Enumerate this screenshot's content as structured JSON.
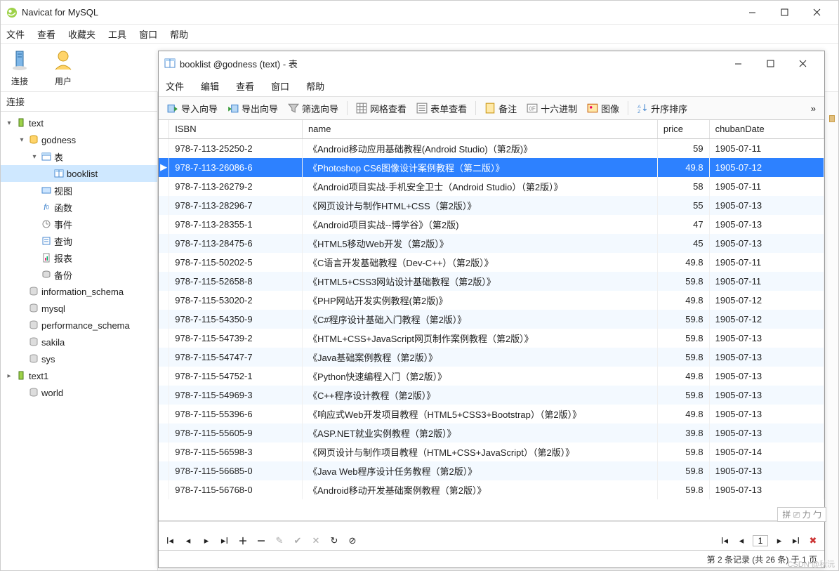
{
  "app": {
    "title": "Navicat for MySQL",
    "menubar": [
      "文件",
      "查看",
      "收藏夹",
      "工具",
      "窗口",
      "帮助"
    ],
    "toolbar": [
      {
        "label": "连接",
        "icon": "server"
      },
      {
        "label": "用户",
        "icon": "user"
      }
    ],
    "sidebar_title": "连接"
  },
  "tree": {
    "root": {
      "label": "text",
      "expanded": true
    },
    "db": {
      "label": "godness",
      "expanded": true
    },
    "tables_group": {
      "label": "表",
      "expanded": true
    },
    "table_item": {
      "label": "booklist"
    },
    "others": [
      "视图",
      "函数",
      "事件",
      "查询",
      "报表",
      "备份"
    ],
    "rest": [
      "information_schema",
      "mysql",
      "performance_schema",
      "sakila",
      "sys",
      "text1",
      "world"
    ]
  },
  "sub": {
    "title": "booklist @godness (text) - 表",
    "menubar": [
      "文件",
      "编辑",
      "查看",
      "窗口",
      "帮助"
    ],
    "toolbar": {
      "import": "导入向导",
      "export": "导出向导",
      "filter": "筛选向导",
      "gridview": "网格查看",
      "formview": "表单查看",
      "memo": "备注",
      "hex": "十六进制",
      "image": "图像",
      "sort": "升序排序"
    },
    "columns": [
      "ISBN",
      "name",
      "price",
      "chubanDate"
    ],
    "rows": [
      [
        "978-7-113-25250-2",
        "《Android移动应用基础教程(Android Studio)（第2版)》",
        "59",
        "1905-07-11"
      ],
      [
        "978-7-113-26086-6",
        "《Photoshop CS6图像设计案例教程（第二版）》",
        "49.8",
        "1905-07-12"
      ],
      [
        "978-7-113-26279-2",
        "《Android项目实战-手机安全卫士（Android Studio）（第2版）》",
        "58",
        "1905-07-11"
      ],
      [
        "978-7-113-28296-7",
        "《网页设计与制作HTML+CSS（第2版）》",
        "55",
        "1905-07-13"
      ],
      [
        "978-7-113-28355-1",
        "《Android项目实战--博学谷》（第2版)",
        "47",
        "1905-07-13"
      ],
      [
        "978-7-113-28475-6",
        "《HTML5移动Web开发（第2版）》",
        "45",
        "1905-07-13"
      ],
      [
        "978-7-115-50202-5",
        "《C语言开发基础教程（Dev-C++）（第2版）》",
        "49.8",
        "1905-07-11"
      ],
      [
        "978-7-115-52658-8",
        "《HTML5+CSS3网站设计基础教程（第2版）》",
        "59.8",
        "1905-07-11"
      ],
      [
        "978-7-115-53020-2",
        "《PHP网站开发实例教程(第2版)》",
        "49.8",
        "1905-07-12"
      ],
      [
        "978-7-115-54350-9",
        "《C#程序设计基础入门教程（第2版）》",
        "59.8",
        "1905-07-12"
      ],
      [
        "978-7-115-54739-2",
        "《HTML+CSS+JavaScript网页制作案例教程（第2版）》",
        "59.8",
        "1905-07-13"
      ],
      [
        "978-7-115-54747-7",
        "《Java基础案例教程（第2版）》",
        "59.8",
        "1905-07-13"
      ],
      [
        "978-7-115-54752-1",
        "《Python快速编程入门（第2版）》",
        "49.8",
        "1905-07-13"
      ],
      [
        "978-7-115-54969-3",
        "《C++程序设计教程（第2版）》",
        "59.8",
        "1905-07-13"
      ],
      [
        "978-7-115-55396-6",
        "《响应式Web开发项目教程（HTML5+CSS3+Bootstrap）（第2版）》",
        "49.8",
        "1905-07-13"
      ],
      [
        "978-7-115-55605-9",
        "《ASP.NET就业实例教程（第2版）》",
        "39.8",
        "1905-07-13"
      ],
      [
        "978-7-115-56598-3",
        "《网页设计与制作项目教程（HTML+CSS+JavaScript）（第2版）》",
        "59.8",
        "1905-07-14"
      ],
      [
        "978-7-115-56685-0",
        "《Java Web程序设计任务教程（第2版）》",
        "59.8",
        "1905-07-13"
      ],
      [
        "978-7-115-56768-0",
        "《Android移动开发基础案例教程（第2版）》",
        "59.8",
        "1905-07-13"
      ]
    ],
    "selected_row": 1,
    "status": "第 2 条记录 (共 26 条) 于 1 页",
    "page_input": "1"
  },
  "watermark": "CSDN @秋沅",
  "ime": "拼"
}
